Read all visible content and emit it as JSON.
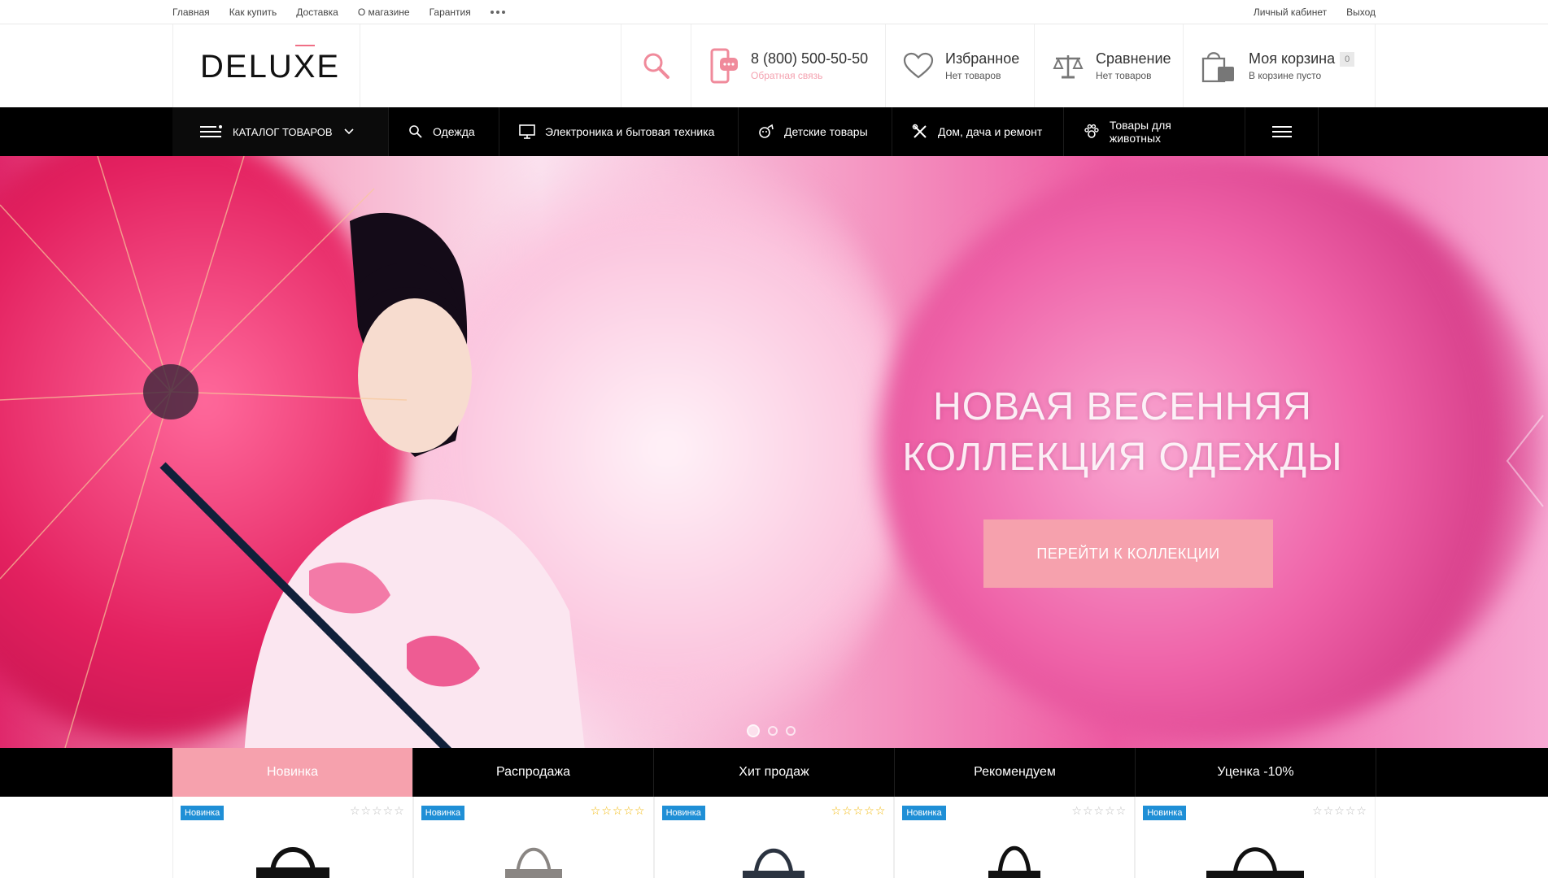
{
  "topbar": {
    "links": [
      "Главная",
      "Как купить",
      "Доставка",
      "О магазине",
      "Гарантия"
    ],
    "right": [
      "Личный кабинет",
      "Выход"
    ]
  },
  "header": {
    "logo_pre": "DELU",
    "logo_x": "X",
    "logo_post": "E",
    "phone": "8 (800) 500-50-50",
    "callback": "Обратная связь",
    "favorites_title": "Избранное",
    "favorites_sub": "Нет товаров",
    "compare_title": "Сравнение",
    "compare_sub": "Нет товаров",
    "cart_title": "Моя корзина",
    "cart_count": "0",
    "cart_sub": "В корзине пусто"
  },
  "nav": {
    "catalog": "КАТАЛОГ ТОВАРОВ",
    "items": [
      "Одежда",
      "Электроника и бытовая техника",
      "Детские товары",
      "Дом, дача и ремонт",
      "Товары для животных"
    ]
  },
  "hero": {
    "title_line1": "НОВАЯ ВЕСЕННЯЯ",
    "title_line2": "КОЛЛЕКЦИЯ ОДЕЖДЫ",
    "button": "ПЕРЕЙТИ К КОЛЛЕКЦИИ"
  },
  "tabs": [
    "Новинка",
    "Распродажа",
    "Хит продаж",
    "Рекомендуем",
    "Уценка -10%"
  ],
  "products": [
    {
      "tag": "Новинка",
      "rating": 0
    },
    {
      "tag": "Новинка",
      "rating": 5
    },
    {
      "tag": "Новинка",
      "rating": 5
    },
    {
      "tag": "Новинка",
      "rating": 0
    },
    {
      "tag": "Новинка",
      "rating": 0
    }
  ],
  "colors": {
    "accent": "#f6a1ad",
    "nav_bg": "#000000",
    "tag_blue": "#1f8fd6",
    "star_gold": "#f2b705"
  }
}
